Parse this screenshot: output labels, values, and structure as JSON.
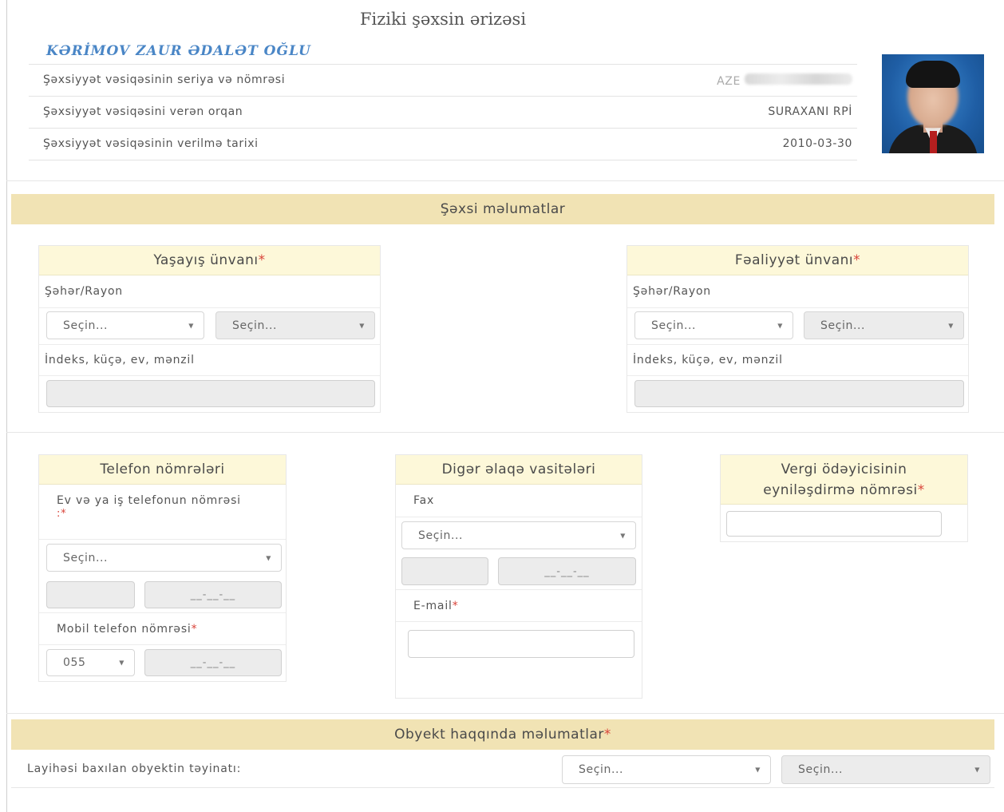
{
  "header": {
    "title": "Fiziki şəxsin ərizəsi",
    "person_name": "KƏRİMOV ZAUR ƏDALƏT OĞLU",
    "id_rows": [
      {
        "label": "Şəxsiyyət vəsiqəsinin seriya və nömrəsi",
        "value": "AZE"
      },
      {
        "label": "Şəxsiyyət vəsiqəsini verən orqan",
        "value": "SURAXANI RPİ"
      },
      {
        "label": "Şəxsiyyət vəsiqəsinin verilmə tarixi",
        "value": "2010-03-30"
      }
    ]
  },
  "personal": {
    "section_title": "Şəxsi məlumatlar",
    "residence": {
      "title": "Yaşayış ünvanı",
      "required_mark": "*",
      "city_label": "Şəhər/Rayon",
      "select1": "Seçin...",
      "select2": "Seçin...",
      "address_label": "İndeks, küçə, ev, mənzil"
    },
    "activity": {
      "title": "Fəaliyyət ünvanı",
      "required_mark": "*",
      "city_label": "Şəhər/Rayon",
      "select1": "Seçin...",
      "select2": "Seçin...",
      "address_label": "İndeks, küçə, ev, mənzil"
    }
  },
  "contacts": {
    "phones": {
      "title": "Telefon nömrələri",
      "home_label": "Ev və ya iş telefonun nömrəsi",
      "home_mark": ":*",
      "home_select": "Seçin...",
      "home_mask": "__-__-__",
      "mobile_label": "Mobil telefon nömrəsi",
      "mobile_mark": "*",
      "mobile_prefix": "055",
      "mobile_mask": "__-__-__"
    },
    "other": {
      "title": "Digər əlaqə vasitələri",
      "fax_label": "Fax",
      "fax_select": "Seçin...",
      "fax_mask": "__-__-__",
      "email_label": "E-mail",
      "email_mark": "*"
    },
    "tax": {
      "title_line1": "Vergi ödəyicisinin",
      "title_line2": "eyniləşdirmə nömrəsi",
      "required_mark": "*"
    }
  },
  "object": {
    "section_title": "Obyekt haqqında məlumatlar",
    "required_mark": "*",
    "purpose_label": "Layihəsi  baxılan obyektin təyinatı:",
    "select1": "Seçin...",
    "select2": "Seçin..."
  },
  "colors": {
    "section_bar": "#f1e3b4",
    "box_header": "#fdf8d9",
    "name_blue": "#4a86c6",
    "required_red": "#d9443a"
  }
}
